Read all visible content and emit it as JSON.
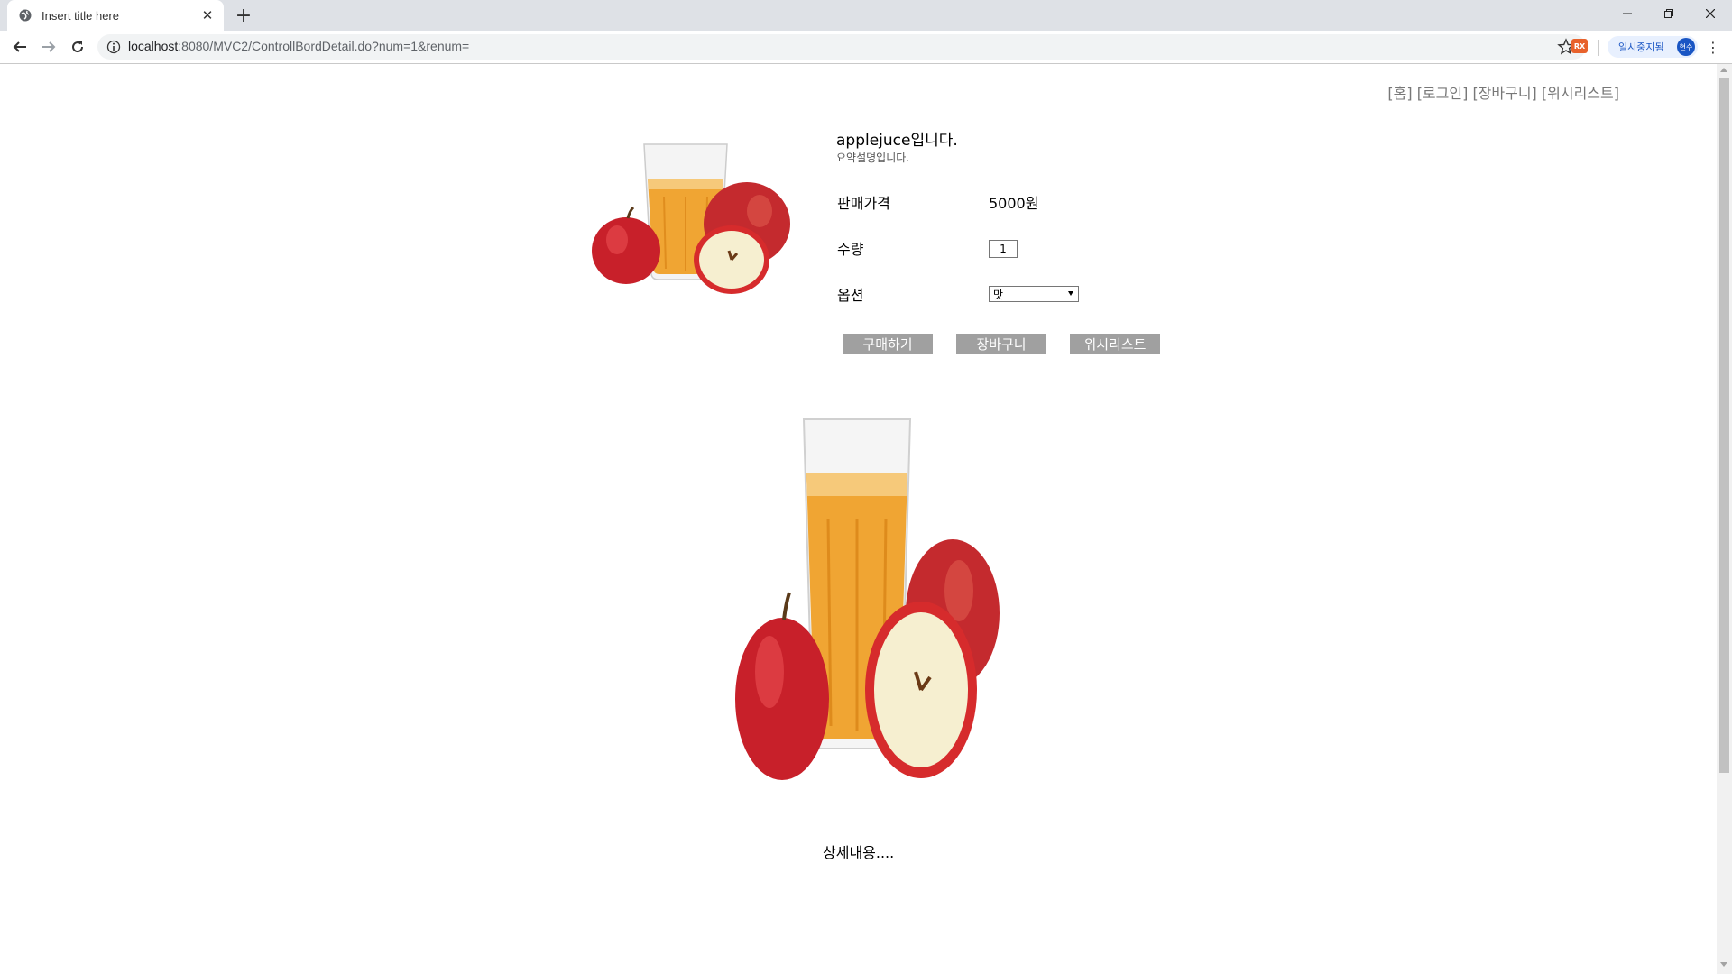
{
  "browser": {
    "tab_title": "Insert title here",
    "url_host": "localhost",
    "url_rest": ":8080/MVC2/ControllBordDetail.do?num=1&renum=",
    "extension_label": "RX",
    "profile_status": "일시중지됨",
    "profile_avatar": "현수"
  },
  "nav": {
    "home": "[홈]",
    "login": "[로그인]",
    "cart": "[장바구니]",
    "wishlist": "[위시리스트]"
  },
  "product": {
    "name": "applejuce입니다.",
    "summary": "요약설명입니다.",
    "price_label": "판매가격",
    "price_value": "5000원",
    "quantity_label": "수량",
    "quantity_value": "1",
    "option_label": "옵션",
    "option_value": "맛"
  },
  "buttons": {
    "buy": "구매하기",
    "cart": "장바구니",
    "wishlist": "위시리스트"
  },
  "detail": {
    "text": "상세내용...."
  },
  "colors": {
    "button_bg": "#a0a0a0",
    "nav_text": "#777777",
    "juice": "#f0a030",
    "apple": "#c8202a"
  }
}
